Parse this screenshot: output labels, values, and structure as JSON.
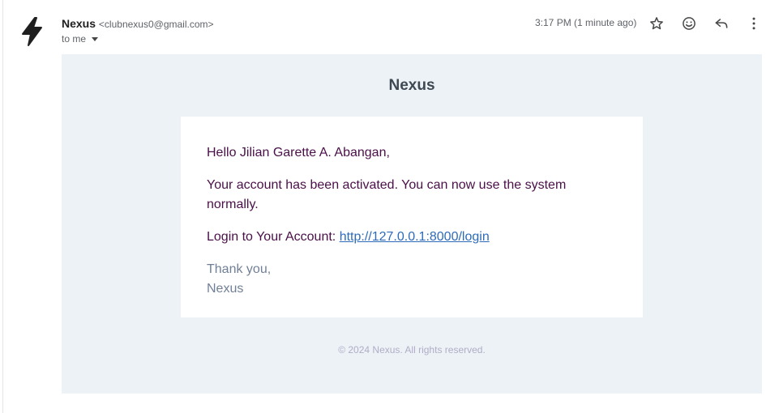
{
  "header": {
    "avatar_icon": "lightning-bolt-icon",
    "sender_name": "Nexus",
    "sender_email": "<clubnexus0@gmail.com>",
    "recipient": "to me",
    "timestamp": "3:17 PM (1 minute ago)",
    "actions": [
      {
        "name": "star",
        "icon": "star-icon"
      },
      {
        "name": "emoji",
        "icon": "smiley-icon"
      },
      {
        "name": "reply",
        "icon": "reply-icon"
      },
      {
        "name": "more",
        "icon": "more-vert-icon"
      }
    ]
  },
  "email": {
    "brand_title": "Nexus",
    "greeting": "Hello Jilian Garette A. Abangan,",
    "message": "Your account has been activated. You can now use the system normally.",
    "login_label": "Login to Your Account: ",
    "login_link": "http://127.0.0.1:8000/login",
    "thanks": "Thank you,",
    "signature": "Nexus",
    "footer": "© 2024 Nexus. All rights reserved."
  },
  "colors": {
    "body_bg": "#edf2f7",
    "card_bg": "#ffffff",
    "brand_title": "#3d4852",
    "text": "#4a0f48",
    "link": "#2d6bb8",
    "muted": "#718096",
    "footer": "#b0adc5"
  }
}
